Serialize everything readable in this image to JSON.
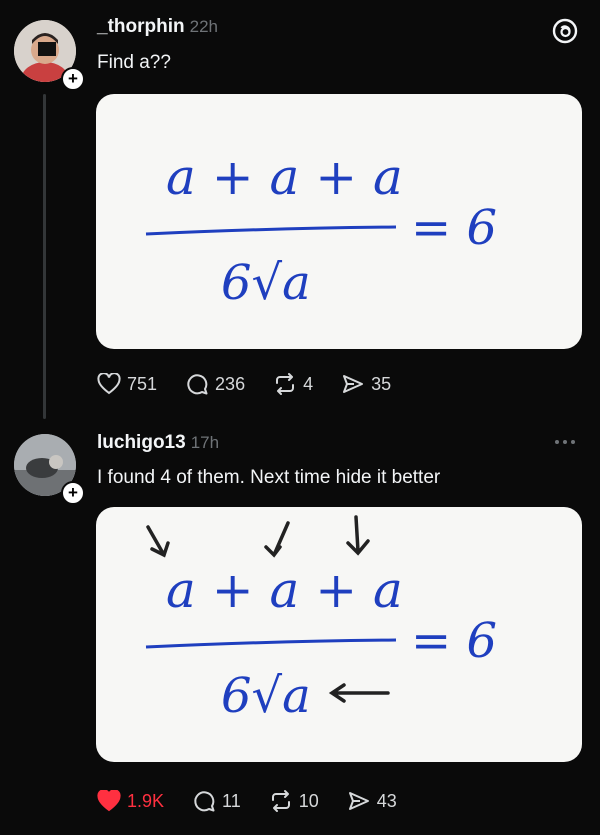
{
  "app": {
    "logo_icon": "threads-logo-icon"
  },
  "posts": [
    {
      "username": "_thorphin",
      "time": "22h",
      "text": "Find a??",
      "image": {
        "numerator": "a + a + a",
        "denominator": "6√a",
        "rhs": "= 6"
      },
      "stats": {
        "likes": "751",
        "comments": "236",
        "reposts": "4",
        "shares": "35"
      },
      "liked": false
    },
    {
      "username": "luchigo13",
      "time": "17h",
      "text": "I found 4 of them. Next time hide it better",
      "image": {
        "numerator": "a + a + a",
        "denominator": "6√a",
        "rhs": "= 6"
      },
      "stats": {
        "likes": "1.9K",
        "comments": "11",
        "reposts": "10",
        "shares": "43"
      },
      "liked": true
    }
  ],
  "colors": {
    "like_active": "#ff3040",
    "ink": "#1f3fbf"
  }
}
